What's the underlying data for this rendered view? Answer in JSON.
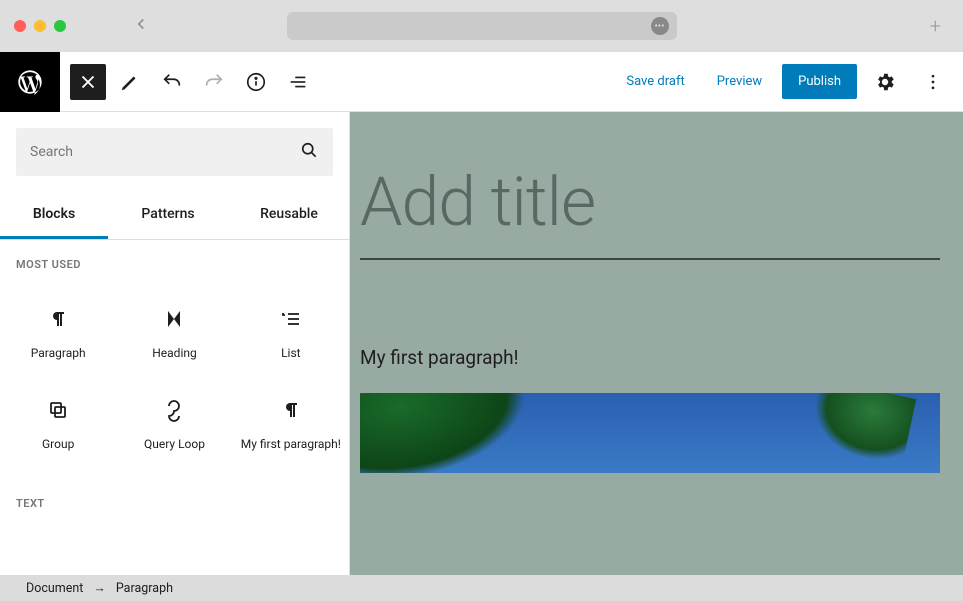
{
  "toolbar": {
    "save_draft": "Save draft",
    "preview": "Preview",
    "publish": "Publish"
  },
  "inserter": {
    "search_placeholder": "Search",
    "tabs": {
      "blocks": "Blocks",
      "patterns": "Patterns",
      "reusable": "Reusable"
    },
    "sections": {
      "most_used": "MOST USED",
      "text": "TEXT"
    },
    "blocks": {
      "paragraph": "Paragraph",
      "heading": "Heading",
      "list": "List",
      "group": "Group",
      "query_loop": "Query Loop",
      "my_first": "My first paragraph!"
    }
  },
  "canvas": {
    "title_placeholder": "Add title",
    "paragraph": "My first paragraph!"
  },
  "breadcrumb": {
    "document": "Document",
    "current": "Paragraph"
  }
}
